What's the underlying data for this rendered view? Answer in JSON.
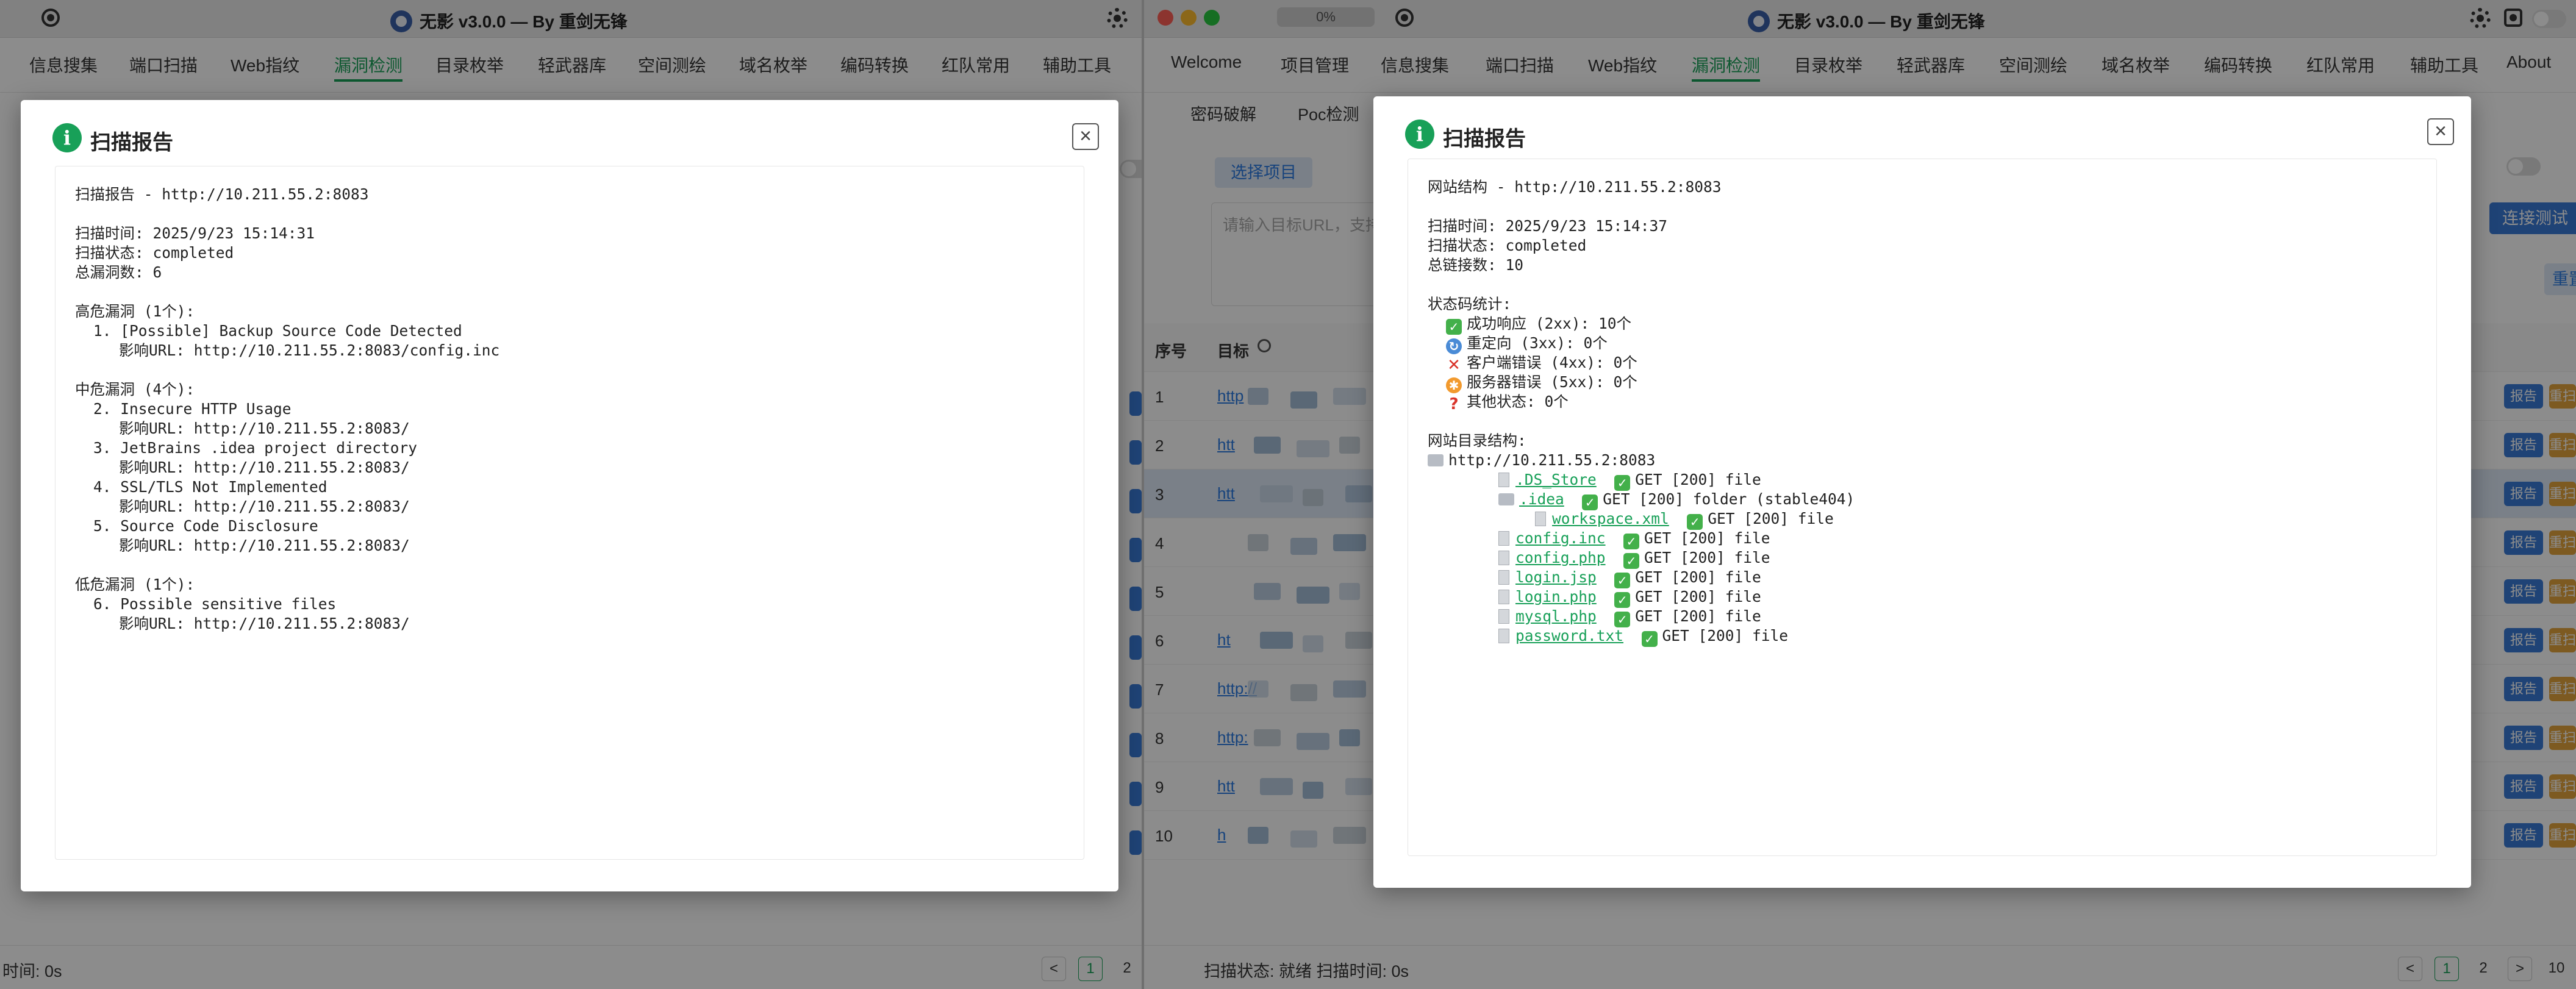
{
  "left_window": {
    "title": "无影 v3.0.0 — By 重剑无锋",
    "menu": [
      "信息搜集",
      "端口扫描",
      "Web指纹",
      "漏洞检测",
      "目录枚举",
      "轻武器库",
      "空间测绘",
      "域名枚举",
      "编码转换",
      "红队常用",
      "辅助工具"
    ],
    "active_menu": "漏洞检测",
    "status_text": "时间: 0s",
    "pager": [
      "<",
      "1",
      "2"
    ],
    "dialog": {
      "title": "扫描报告",
      "close": "×",
      "lines": [
        {
          "t": "扫描报告 - http://10.211.55.2:8083",
          "c": ""
        },
        {
          "t": "",
          "c": "blank"
        },
        {
          "t": "扫描时间: 2025/9/23 15:14:31",
          "c": ""
        },
        {
          "t": "扫描状态: completed",
          "c": ""
        },
        {
          "t": "总漏洞数: 6",
          "c": ""
        },
        {
          "t": "",
          "c": "blank"
        },
        {
          "t": "高危漏洞 (1个):",
          "c": ""
        },
        {
          "t": "1. [Possible] Backup Source Code Detected",
          "c": "ind1"
        },
        {
          "t": "影响URL: http://10.211.55.2:8083/config.inc",
          "c": "ind2"
        },
        {
          "t": "",
          "c": "blank"
        },
        {
          "t": "中危漏洞 (4个):",
          "c": ""
        },
        {
          "t": "2. Insecure HTTP Usage",
          "c": "ind1"
        },
        {
          "t": "影响URL: http://10.211.55.2:8083/",
          "c": "ind2"
        },
        {
          "t": "3. JetBrains .idea project directory",
          "c": "ind1"
        },
        {
          "t": "影响URL: http://10.211.55.2:8083/",
          "c": "ind2"
        },
        {
          "t": "4. SSL/TLS Not Implemented",
          "c": "ind1"
        },
        {
          "t": "影响URL: http://10.211.55.2:8083/",
          "c": "ind2"
        },
        {
          "t": "5. Source Code Disclosure",
          "c": "ind1"
        },
        {
          "t": "影响URL: http://10.211.55.2:8083/",
          "c": "ind2"
        },
        {
          "t": "",
          "c": "blank"
        },
        {
          "t": "低危漏洞 (1个):",
          "c": ""
        },
        {
          "t": "6. Possible sensitive files",
          "c": "ind1"
        },
        {
          "t": "影响URL: http://10.211.55.2:8083/",
          "c": "ind2"
        }
      ]
    }
  },
  "right_window": {
    "title": "无影 v3.0.0 — By 重剑无锋",
    "progress_label": "0%",
    "progress_value": 0,
    "menu": [
      "Welcome",
      "项目管理",
      "信息搜集",
      "端口扫描",
      "Web指纹",
      "漏洞检测",
      "目录枚举",
      "轻武器库",
      "空间测绘",
      "域名枚举",
      "编码转换",
      "红队常用",
      "辅助工具",
      "About"
    ],
    "active_menu": "漏洞检测",
    "subtabs": [
      "密码破解",
      "Poc检测"
    ],
    "select_project_label": "选择项目",
    "input_placeholder": "请输入目标URL，支持",
    "connect_test_label": "连接测试",
    "reset_label": "重置",
    "table_headers": [
      "序号",
      "目标"
    ],
    "rows": [
      {
        "num": "1",
        "link": "http"
      },
      {
        "num": "2",
        "link": "htt"
      },
      {
        "num": "3",
        "link": "htt"
      },
      {
        "num": "4",
        "link": ""
      },
      {
        "num": "5",
        "link": ""
      },
      {
        "num": "6",
        "link": "ht"
      },
      {
        "num": "7",
        "link": "http://"
      },
      {
        "num": "8",
        "link": "http:"
      },
      {
        "num": "9",
        "link": "htt"
      },
      {
        "num": "10",
        "link": "h"
      }
    ],
    "row_report_label": "报告",
    "row_rescan_label": "重扫",
    "status_text": "扫描状态: 就绪   扫描时间: 0s",
    "pager": [
      "<",
      "1",
      "2",
      ">",
      "10"
    ],
    "dialog": {
      "title": "扫描报告",
      "close": "×",
      "header_lines": [
        {
          "t": "网站结构 - http://10.211.55.2:8083",
          "c": ""
        },
        {
          "t": "",
          "c": "blank"
        },
        {
          "t": "扫描时间: 2025/9/23 15:14:37",
          "c": ""
        },
        {
          "t": "扫描状态: completed",
          "c": ""
        },
        {
          "t": "总链接数: 10",
          "c": ""
        },
        {
          "t": "",
          "c": "blank"
        },
        {
          "t": "状态码统计:",
          "c": ""
        }
      ],
      "status_stats": [
        {
          "icon": "check-icon",
          "t": "成功响应 (2xx): 10个"
        },
        {
          "icon": "redirect-icon",
          "t": "重定向 (3xx): 0个"
        },
        {
          "icon": "cross-icon",
          "t": "客户端错误 (4xx): 0个"
        },
        {
          "icon": "burst-icon",
          "t": "服务器错误 (5xx): 0个"
        },
        {
          "icon": "question-icon",
          "t": "其他状态: 0个"
        }
      ],
      "tree_title": "网站目录结构:",
      "root": "http://10.211.55.2:8083",
      "tree": [
        {
          "level": 1,
          "kind": "file",
          "name": ".DS_Store",
          "info": "GET [200] file"
        },
        {
          "level": 1,
          "kind": "folder",
          "name": ".idea",
          "info": "GET [200] folder (stable404)"
        },
        {
          "level": 2,
          "kind": "file",
          "name": "workspace.xml",
          "info": "GET [200] file"
        },
        {
          "level": 1,
          "kind": "file",
          "name": "config.inc",
          "info": "GET [200] file"
        },
        {
          "level": 1,
          "kind": "file",
          "name": "config.php",
          "info": "GET [200] file"
        },
        {
          "level": 1,
          "kind": "file",
          "name": "login.jsp",
          "info": "GET [200] file"
        },
        {
          "level": 1,
          "kind": "file",
          "name": "login.php",
          "info": "GET [200] file"
        },
        {
          "level": 1,
          "kind": "file",
          "name": "mysql.php",
          "info": "GET [200] file"
        },
        {
          "level": 1,
          "kind": "file",
          "name": "password.txt",
          "info": "GET [200] file"
        }
      ]
    }
  },
  "colors": {
    "accent_green": "#18a058",
    "link_blue": "#2a7ae2",
    "button_blue": "#3a7ad8",
    "button_orange": "#e3a43c"
  }
}
